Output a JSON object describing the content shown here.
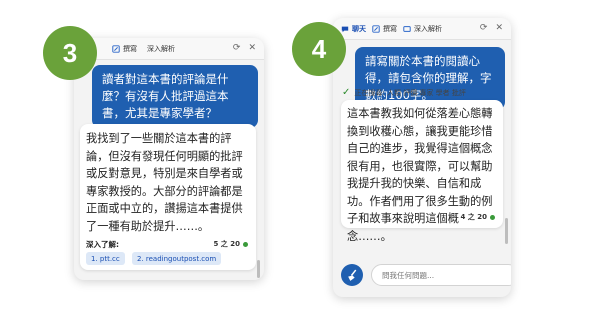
{
  "steps": {
    "left": "3",
    "right": "4"
  },
  "left_panel": {
    "tabs": [
      {
        "label": "撰寫"
      },
      {
        "label": "深入解析"
      }
    ],
    "user_message": "讀者對這本書的評論是什麼？有沒有人批評過這本書，尤其是專家學者？",
    "bot_reply": "我找到了一些關於這本書的評論，但沒有發現任何明顯的批評或反對意見，特別是來自學者或專家教授的。大部分的評論都是正面或中立的，讚揚這本書提供了一種有助於提升……。",
    "counter": "5 之 20",
    "learn_more_label": "深入了解:",
    "sources": [
      "1. ptt.cc",
      "2. readingoutpost.com"
    ]
  },
  "right_panel": {
    "tabs": [
      {
        "label": "聊天"
      },
      {
        "label": "撰寫"
      },
      {
        "label": "深入解析"
      }
    ],
    "user_message": "請寫關於本書的閱讀心得，請包含你的理解，字數約100字。",
    "status": "正在搜尋: 人類 評價 專家 學者 批評",
    "bot_reply": "這本書教我如何從落差心態轉換到收穫心態，讓我更能珍惜自己的進步，我覺得這個概念很有用，也很實際，可以幫助我提升我的快樂、自信和成功。作者們用了很多生動的例子和故事來說明這個概念……。",
    "counter": "4 之 20",
    "input_placeholder": "問我任何問題..."
  },
  "colors": {
    "badge": "#6aa23a",
    "user_bubble": "#1f5fb0",
    "chip_bg": "#dde8f7",
    "status_dot": "#3a9a3a"
  },
  "icons": [
    "compose-icon",
    "insights-icon",
    "chat-icon",
    "refresh-icon",
    "close-icon",
    "check-icon",
    "broom-icon"
  ]
}
